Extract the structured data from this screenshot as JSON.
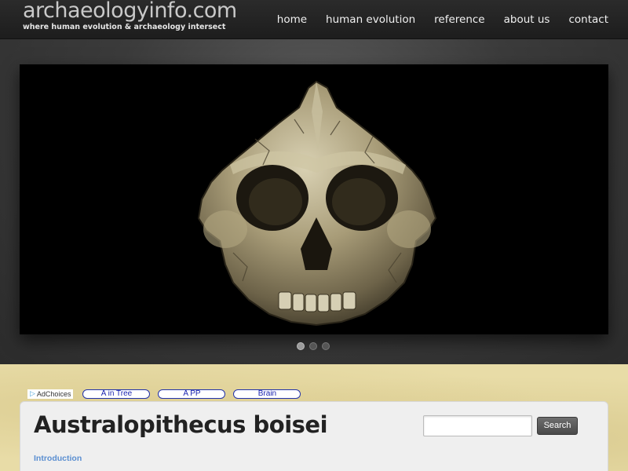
{
  "header": {
    "logo_title": "archaeologyinfo.com",
    "logo_tagline": "where human evolution & archaeology intersect",
    "nav": [
      {
        "label": "home"
      },
      {
        "label": "human evolution"
      },
      {
        "label": "reference"
      },
      {
        "label": "about us"
      },
      {
        "label": "contact"
      }
    ]
  },
  "slider": {
    "image": "Australopithecus boisei skull on black background",
    "dots": 3,
    "active_dot": 1
  },
  "ads": {
    "adchoices_label": "AdChoices",
    "links": [
      {
        "label": "A in Tree"
      },
      {
        "label": "A PP"
      },
      {
        "label": "Brain"
      }
    ]
  },
  "main": {
    "title": "Australopithecus boisei",
    "section_link": "Introduction"
  },
  "search": {
    "value": "",
    "button_label": "Search"
  },
  "colors": {
    "header_bg": "#222222",
    "parchment": "#e8dca7",
    "link_blue": "#5b8fd1",
    "ad_link_blue": "#1a24b0"
  }
}
